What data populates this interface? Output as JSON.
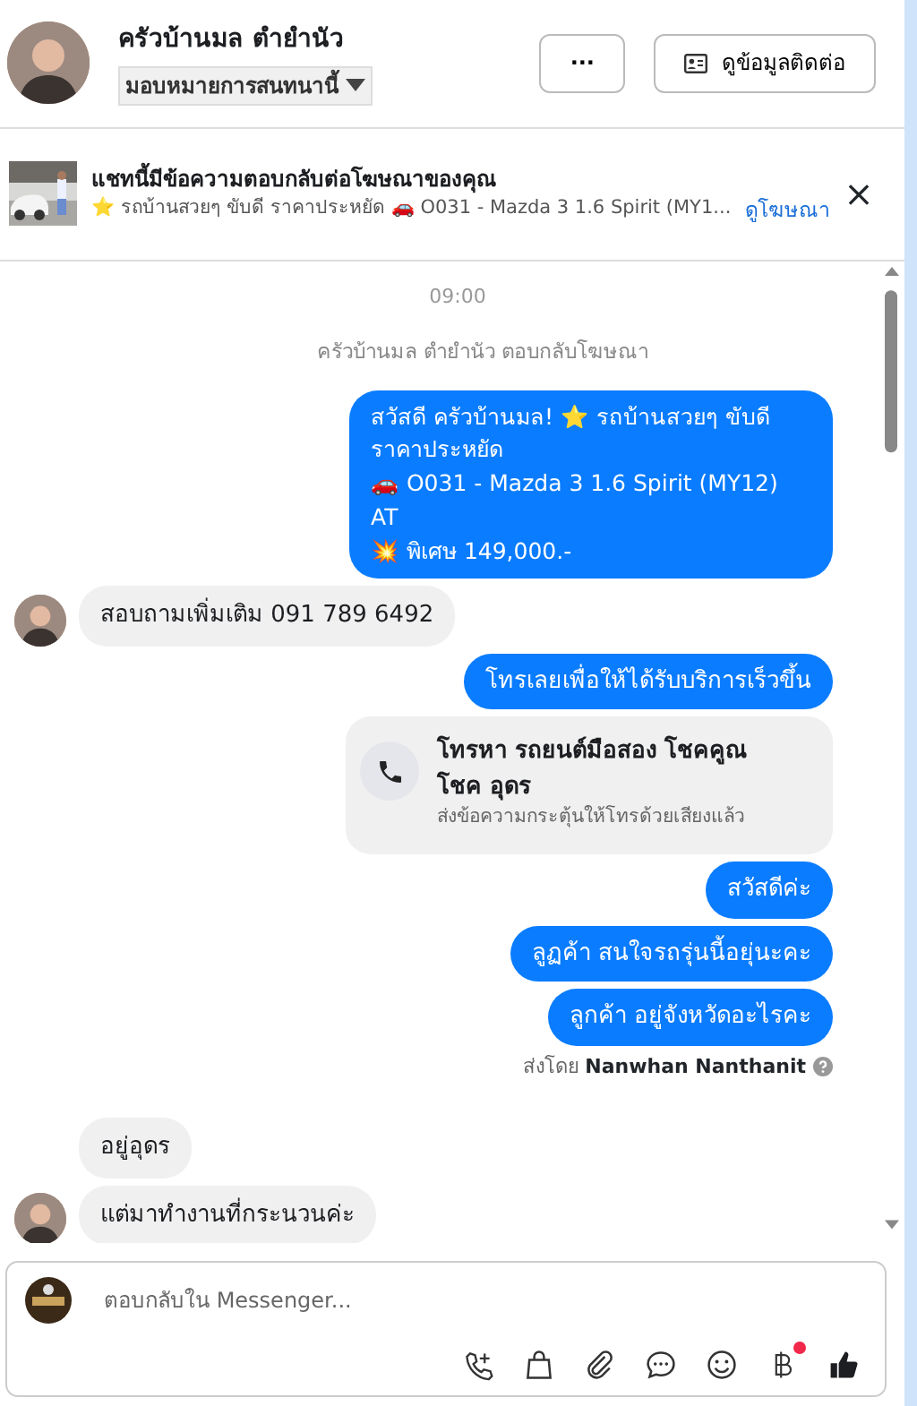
{
  "header": {
    "name": "ครัวบ้านมล ตำยำนัว",
    "assign": "มอบหมายการสนทนานี้",
    "more_label": "···",
    "contact_button": "ดูข้อมูลติดต่อ"
  },
  "ad_banner": {
    "title": "แชทนี้มีข้อความตอบกลับต่อโฆษณาของคุณ",
    "summary": "⭐ รถบ้านสวยๆ ขับดี ราคาประหยัด 🚗 O031 - Mazda 3 1.6 Spirit (MY1...",
    "link": "ดูโฆษณา",
    "close": "×"
  },
  "messages": [
    {
      "kind": "time",
      "text": "09:00"
    },
    {
      "kind": "system",
      "text": "ครัวบ้านมล ตำยำนัว ตอบกลับโฆษณา"
    },
    {
      "kind": "out",
      "lines": [
        "สวัสดี ครัวบ้านมล! ⭐ รถบ้านสวยๆ ขับดี ราคาประหยัด",
        "🚗 O031 - Mazda 3 1.6 Spirit (MY12) AT",
        "💥 พิเศษ 149,000.-"
      ]
    },
    {
      "kind": "in",
      "avatar": true,
      "lines": [
        "สอบถามเพิ่มเติม 091 789 6492"
      ]
    },
    {
      "kind": "out",
      "lines": [
        "โทรเลยเพื่อให้ได้รับบริการเร็วขึ้น"
      ]
    },
    {
      "kind": "call",
      "title": "โทรหา รถยนต์มือสอง โชคคูณ โชค อุดร",
      "subtitle": "ส่งข้อความกระตุ้นให้โทรด้วยเสียงแล้ว"
    },
    {
      "kind": "out",
      "lines": [
        "สวัสดีค่ะ"
      ]
    },
    {
      "kind": "out",
      "lines": [
        "ลูฏค้า สนใจรถรุ่นนี้อยุ่นะคะ"
      ]
    },
    {
      "kind": "out",
      "lines": [
        "ลูกค้า อยู่จังหวัดอะไรคะ"
      ]
    },
    {
      "kind": "sent_by",
      "prefix": "ส่งโดย",
      "name": "Nanwhan Nanthanit"
    },
    {
      "kind": "in",
      "avatar": false,
      "lines": [
        "อยู่อุดร"
      ]
    },
    {
      "kind": "in",
      "avatar": true,
      "lines": [
        "แต่มาทำงานที่กระนวนค่ะ"
      ]
    }
  ],
  "composer": {
    "placeholder": "ตอบกลับใน Messenger...",
    "payment_notification": true
  }
}
